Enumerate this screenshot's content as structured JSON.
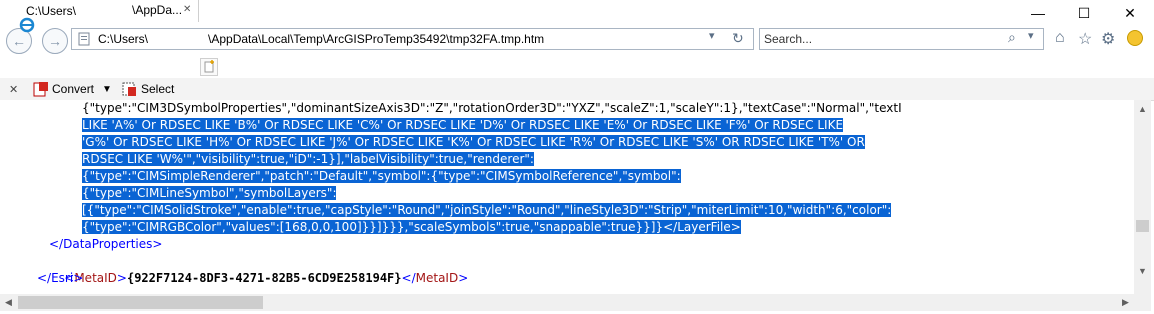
{
  "window": {
    "minimize_glyph": "—",
    "maximize_glyph": "☐",
    "close_glyph": "✕"
  },
  "address": {
    "url": "C:\\Users\\                  \\AppData\\Local\\Temp\\ArcGISProTemp35492\\tmp32FA.tmp.htm",
    "refresh_glyph": "↻"
  },
  "search": {
    "placeholder": "Search...",
    "glyph": "⌕"
  },
  "tabs": [
    {
      "label": "C:\\Users\\"
    },
    {
      "label": "\\AppDa..."
    }
  ],
  "commands": {
    "close_glyph": "✕",
    "convert_label": "Convert",
    "select_label": "Select"
  },
  "content": {
    "line1": "{\"type\":\"CIM3DSymbolProperties\",\"dominantSizeAxis3D\":\"Z\",\"rotationOrder3D\":\"YXZ\",\"scaleZ\":1,\"scaleY\":1},\"textCase\":\"Normal\",\"textI",
    "line2": "LIKE 'A%' Or RDSEC LIKE 'B%' Or RDSEC LIKE 'C%' Or RDSEC LIKE 'D%' Or RDSEC LIKE 'E%' Or RDSEC LIKE 'F%' Or RDSEC LIKE",
    "line3": "'G%' Or RDSEC LIKE 'H%' Or RDSEC LIKE 'J%' Or RDSEC LIKE 'K%' Or RDSEC LIKE 'R%' Or RDSEC LIKE 'S%' OR RDSEC LIKE 'T%' OR",
    "line4": "RDSEC LIKE 'W%'\",\"visibility\":true,\"iD\":-1}],\"labelVisibility\":true,\"renderer\":",
    "line5": "{\"type\":\"CIMSimpleRenderer\",\"patch\":\"Default\",\"symbol\":{\"type\":\"CIMSymbolReference\",\"symbol\":",
    "line6": "{\"type\":\"CIMLineSymbol\",\"symbolLayers\":",
    "line7": "[{\"type\":\"CIMSolidStroke\",\"enable\":true,\"capStyle\":\"Round\",\"joinStyle\":\"Round\",\"lineStyle3D\":\"Strip\",\"miterLimit\":10,\"width\":6,\"color\":",
    "line8": "{\"type\":\"CIMRGBColor\",\"values\":[168,0,0,100]}}]}}},\"scaleSymbols\":true,\"snappable\":true}}]}</LayerFile>",
    "dataprops_close": "</DataProperties>",
    "metaid_open_lt": "<",
    "metaid_tag": "MetaID",
    "metaid_gt": ">",
    "metaid_value": "{922F7124-8DF3-4271-82B5-6CD9E258194F}",
    "metaid_close_lt": "</",
    "esri_close": "</Esri>"
  },
  "colors": {
    "selection": "#0a64d4",
    "tag_bracket": "#0000ff",
    "tag_name": "#a31515"
  }
}
